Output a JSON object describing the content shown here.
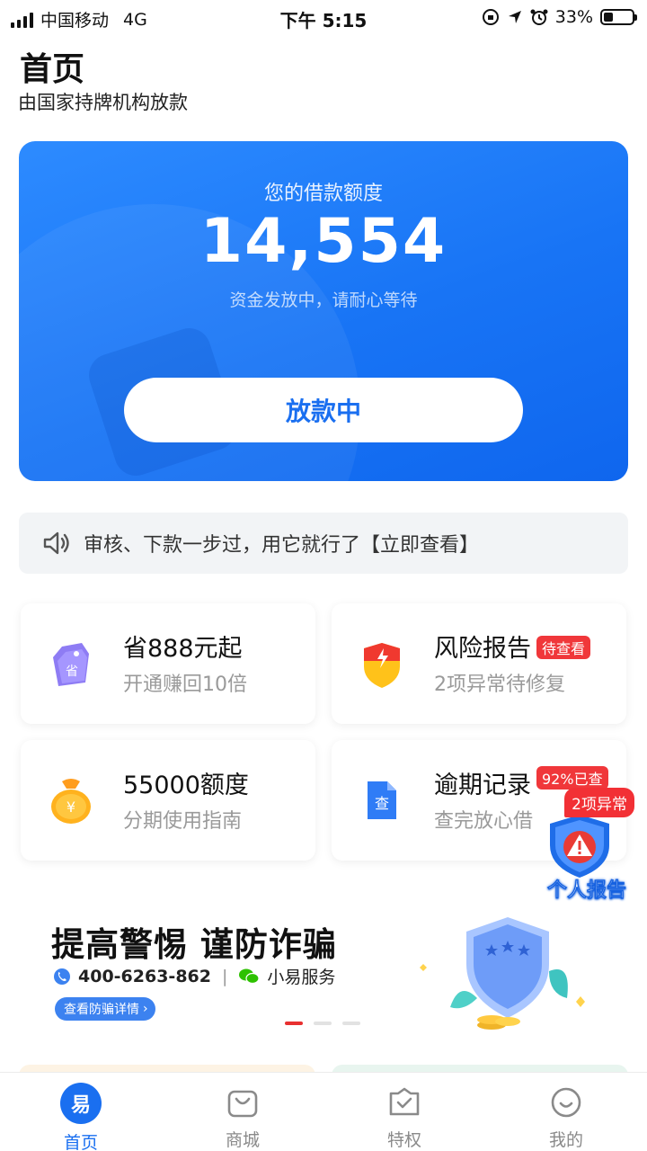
{
  "status_bar": {
    "carrier": "中国移动",
    "network": "4G",
    "time": "下午 5:15",
    "battery": "33%",
    "battery_level": 0.33
  },
  "header": {
    "title": "首页",
    "subtitle": "由国家持牌机构放款"
  },
  "loan_card": {
    "label": "您的借款额度",
    "amount": "14,554",
    "note": "资金发放中，请耐心等待",
    "button_label": "放款中",
    "colors": {
      "from": "#2d8bff",
      "to": "#0f66ee"
    }
  },
  "notice": {
    "text": "审核、下款一步过，用它就行了【立即查看】",
    "icon": "speaker-icon"
  },
  "features": [
    {
      "title": "省888元起",
      "subtitle": "开通赚回10倍",
      "icon": "savings-tag-icon",
      "tag": ""
    },
    {
      "title": "风险报告",
      "subtitle": "2项异常待修复",
      "icon": "risk-shield-icon",
      "tag": "待查看"
    },
    {
      "title": "55000额度",
      "subtitle": "分期使用指南",
      "icon": "money-bag-icon",
      "tag": ""
    },
    {
      "title": "逾期记录",
      "subtitle": "查完放心借",
      "icon": "document-search-icon",
      "tag": "92%已查"
    }
  ],
  "float_report": {
    "badge": "2项异常",
    "label": "个人报告",
    "icon": "warning-shield-icon"
  },
  "banner": {
    "title": "提高警惕 谨防诈骗",
    "phone": "400-6263-862",
    "service": "小易服务",
    "button_label": "查看防骗详情",
    "button_arrow": "›"
  },
  "tabbar": {
    "tabs": [
      {
        "label": "首页",
        "icon": "home-logo-icon",
        "badge_char": "易"
      },
      {
        "label": "商城",
        "icon": "shopping-bag-icon"
      },
      {
        "label": "特权",
        "icon": "privilege-icon"
      },
      {
        "label": "我的",
        "icon": "profile-smile-icon"
      }
    ]
  },
  "colors": {
    "accent": "#1a6ff0",
    "alert": "#f0373a"
  }
}
